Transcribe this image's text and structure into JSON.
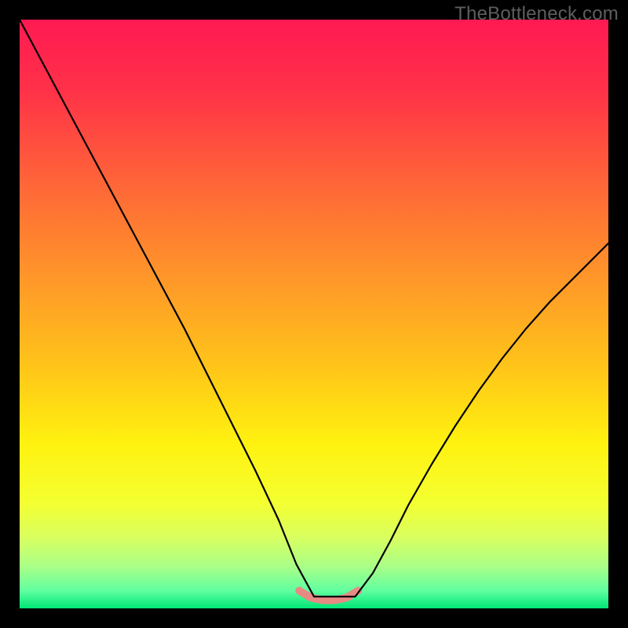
{
  "watermark": "TheBottleneck.com",
  "chart_data": {
    "type": "line",
    "title": "",
    "xlabel": "",
    "ylabel": "",
    "xlim": [
      0,
      1
    ],
    "ylim": [
      0,
      1
    ],
    "grid": false,
    "legend": false,
    "background_gradient": {
      "stops": [
        {
          "offset": 0.0,
          "color": "#ff1a52"
        },
        {
          "offset": 0.12,
          "color": "#ff3148"
        },
        {
          "offset": 0.28,
          "color": "#ff6638"
        },
        {
          "offset": 0.45,
          "color": "#ff9a28"
        },
        {
          "offset": 0.6,
          "color": "#ffc818"
        },
        {
          "offset": 0.72,
          "color": "#fff210"
        },
        {
          "offset": 0.82,
          "color": "#f4ff30"
        },
        {
          "offset": 0.88,
          "color": "#d8ff60"
        },
        {
          "offset": 0.93,
          "color": "#a8ff88"
        },
        {
          "offset": 0.97,
          "color": "#60ffa0"
        },
        {
          "offset": 1.0,
          "color": "#00e676"
        }
      ]
    },
    "series": [
      {
        "name": "bottleneck-curve",
        "color": "#000000",
        "x": [
          0.0,
          0.04,
          0.08,
          0.12,
          0.16,
          0.2,
          0.24,
          0.28,
          0.32,
          0.36,
          0.4,
          0.44,
          0.47,
          0.5,
          0.57,
          0.6,
          0.63,
          0.66,
          0.7,
          0.74,
          0.78,
          0.82,
          0.86,
          0.9,
          0.94,
          0.98,
          1.0
        ],
        "y": [
          1.0,
          0.925,
          0.85,
          0.775,
          0.7,
          0.625,
          0.55,
          0.475,
          0.395,
          0.315,
          0.235,
          0.15,
          0.075,
          0.02,
          0.02,
          0.06,
          0.115,
          0.175,
          0.245,
          0.31,
          0.37,
          0.425,
          0.475,
          0.52,
          0.56,
          0.6,
          0.62
        ]
      }
    ],
    "highlight": {
      "name": "trough-band",
      "color": "#e88a84",
      "x": [
        0.475,
        0.495,
        0.515,
        0.535,
        0.555,
        0.575
      ],
      "y": [
        0.03,
        0.018,
        0.014,
        0.014,
        0.018,
        0.03
      ]
    }
  }
}
